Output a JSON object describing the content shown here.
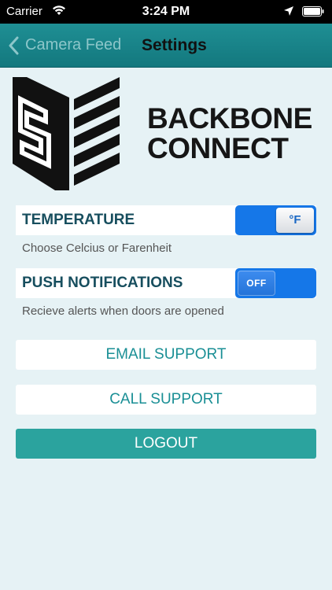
{
  "status_bar": {
    "carrier": "Carrier",
    "time": "3:24 PM"
  },
  "nav": {
    "back_label": "Camera Feed",
    "title": "Settings"
  },
  "brand": {
    "line1": "BACKBONE",
    "line2": "CONNECT"
  },
  "settings": {
    "temperature": {
      "label": "TEMPERATURE",
      "description": "Choose Celcius or Farenheit",
      "toggle_value": "°F"
    },
    "push": {
      "label": "PUSH NOTIFICATIONS",
      "description": "Recieve alerts when doors are opened",
      "toggle_value": "OFF"
    }
  },
  "buttons": {
    "email": "EMAIL SUPPORT",
    "call": "CALL SUPPORT",
    "logout": "LOGOUT"
  },
  "colors": {
    "nav": "#1a868c",
    "toggle": "#1577e8",
    "accent_text": "#1a8f95",
    "logout": "#2ba39e",
    "background": "#e6f2f5"
  }
}
